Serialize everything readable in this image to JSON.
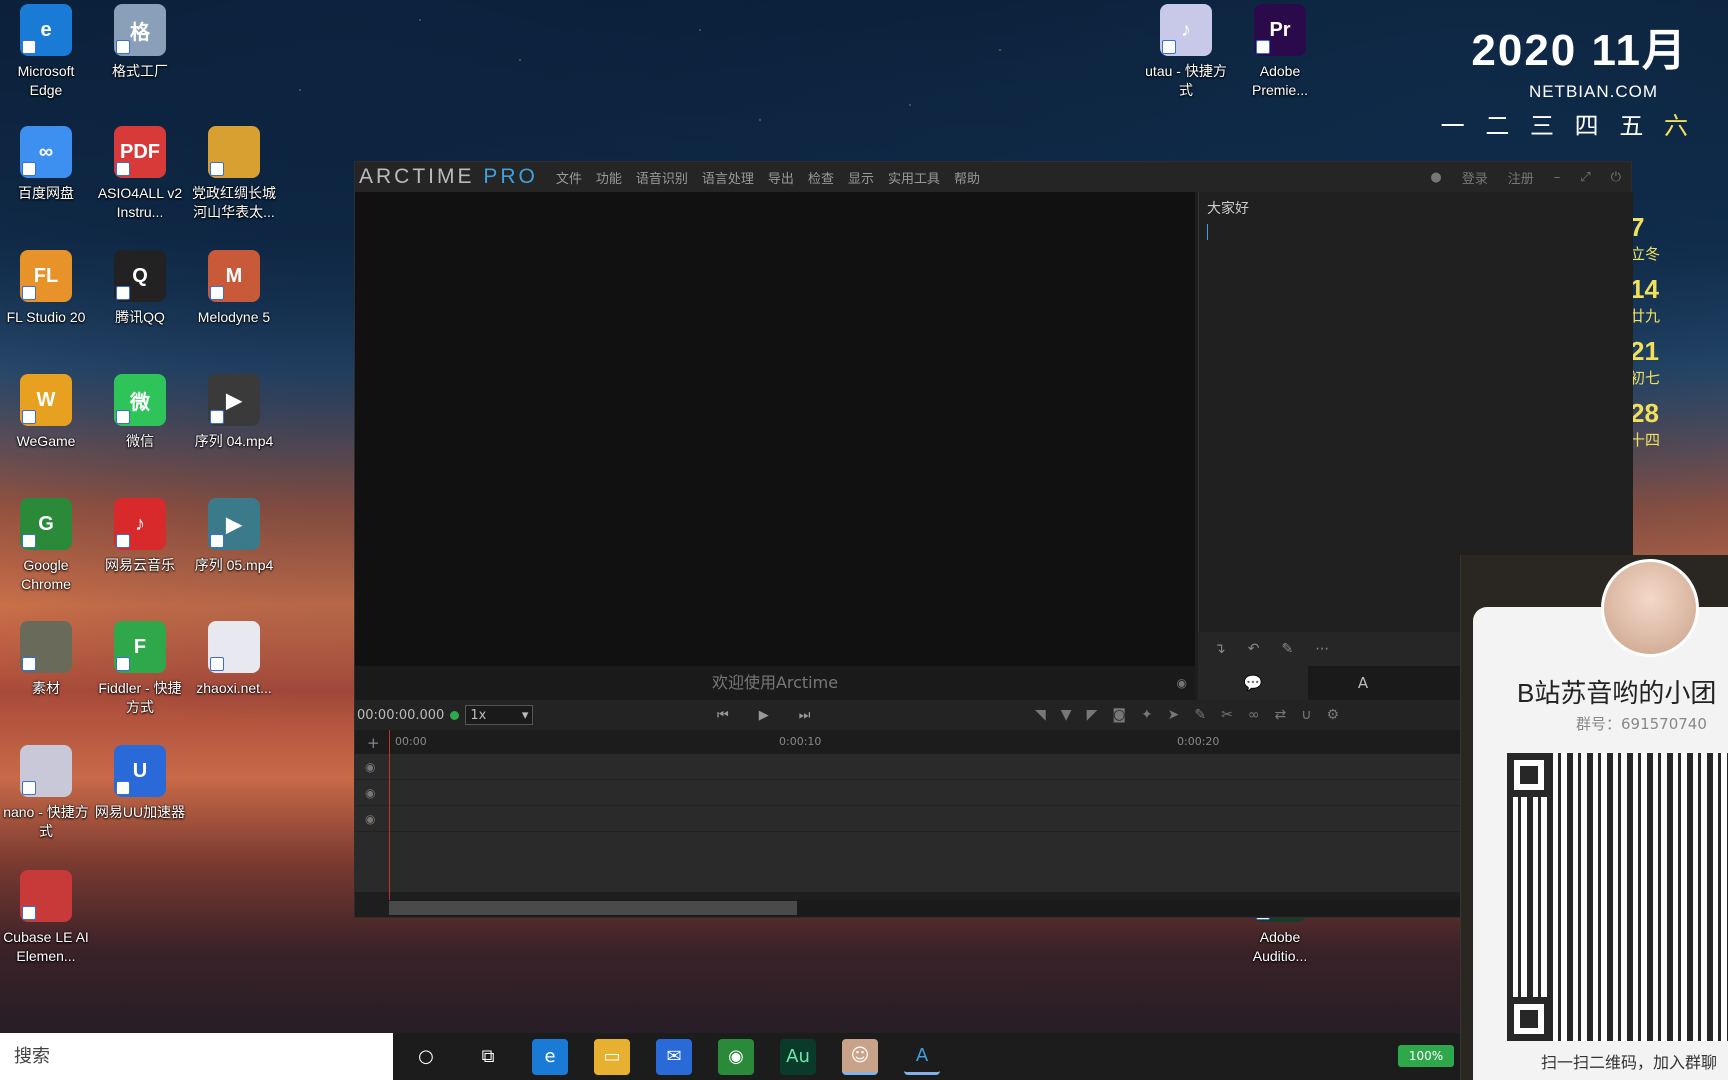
{
  "desktop": {
    "icons": [
      {
        "label": "Microsoft Edge",
        "glyph": "e",
        "color": "#1a7bd6"
      },
      {
        "label": "格式工厂",
        "glyph": "格",
        "color": "#8aa0b8"
      },
      {
        "label": "百度网盘",
        "glyph": "∞",
        "color": "#3d8ff0"
      },
      {
        "label": "ASIO4ALL v2 Instru...",
        "glyph": "PDF",
        "color": "#d83a3a"
      },
      {
        "label": "党政红绸长城河山华表太...",
        "glyph": "",
        "color": "#d8a030"
      },
      {
        "label": "FL Studio 20",
        "glyph": "FL",
        "color": "#e8932a"
      },
      {
        "label": "腾讯QQ",
        "glyph": "Q",
        "color": "#222222"
      },
      {
        "label": "Melodyne 5",
        "glyph": "M",
        "color": "#c85a3a"
      },
      {
        "label": "WeGame",
        "glyph": "W",
        "color": "#e8a020"
      },
      {
        "label": "微信",
        "glyph": "微",
        "color": "#2ec45a"
      },
      {
        "label": "序列 04.mp4",
        "glyph": "▶",
        "color": "#3a3a3a"
      },
      {
        "label": "Google Chrome",
        "glyph": "G",
        "color": "#2a8a3a"
      },
      {
        "label": "网易云音乐",
        "glyph": "♪",
        "color": "#d82a2a"
      },
      {
        "label": "序列 05.mp4",
        "glyph": "▶",
        "color": "#3a7a8a"
      },
      {
        "label": "素材",
        "glyph": "",
        "color": "#6a6a5a"
      },
      {
        "label": "Fiddler - 快捷方式",
        "glyph": "F",
        "color": "#2ea84a"
      },
      {
        "label": "zhaoxi.net...",
        "glyph": "",
        "color": "#e8e8f0"
      },
      {
        "label": "nano - 快捷方式",
        "glyph": "",
        "color": "#c8c8d8"
      },
      {
        "label": "网易UU加速器",
        "glyph": "U",
        "color": "#2a6ad8"
      },
      {
        "label": "Cubase LE AI Elemen...",
        "glyph": "",
        "color": "#c83a3a"
      },
      {
        "label": "utau - 快捷方式",
        "glyph": "♪",
        "color": "#c8c8e8"
      },
      {
        "label": "Adobe Premie...",
        "glyph": "Pr",
        "color": "#2a0a4a"
      },
      {
        "label": "Adobe Auditio...",
        "glyph": "",
        "color": "#1a3a2a"
      }
    ],
    "clock": {
      "year_month": "2020 11月",
      "site": "NETBIAN.COM",
      "weekdays": [
        "一",
        "二",
        "三",
        "四",
        "五",
        "六"
      ]
    },
    "calendar_column": [
      {
        "day": "7",
        "sub": "立冬"
      },
      {
        "day": "14",
        "sub": "廿九"
      },
      {
        "day": "21",
        "sub": "初七"
      },
      {
        "day": "28",
        "sub": "十四"
      }
    ]
  },
  "arctime": {
    "logo_main": "ARCTIME",
    "logo_pro": "PRO",
    "menu": [
      "文件",
      "功能",
      "语音识别",
      "语言处理",
      "导出",
      "检查",
      "显示",
      "实用工具",
      "帮助"
    ],
    "login": "登录",
    "register": "注册",
    "subtitle_text": "大家好",
    "welcome": "欢迎使用Arctime",
    "timecode": "00:00:00.000",
    "speed": "1x",
    "ruler": [
      "00:00",
      "0:00:10",
      "0:00:20"
    ]
  },
  "qr_card": {
    "title": "B站苏音哟的小团",
    "group": "群号：691570740",
    "scan": "扫一扫二维码，加入群聊"
  },
  "taskbar": {
    "search_placeholder": "搜索",
    "battery": "100%"
  }
}
